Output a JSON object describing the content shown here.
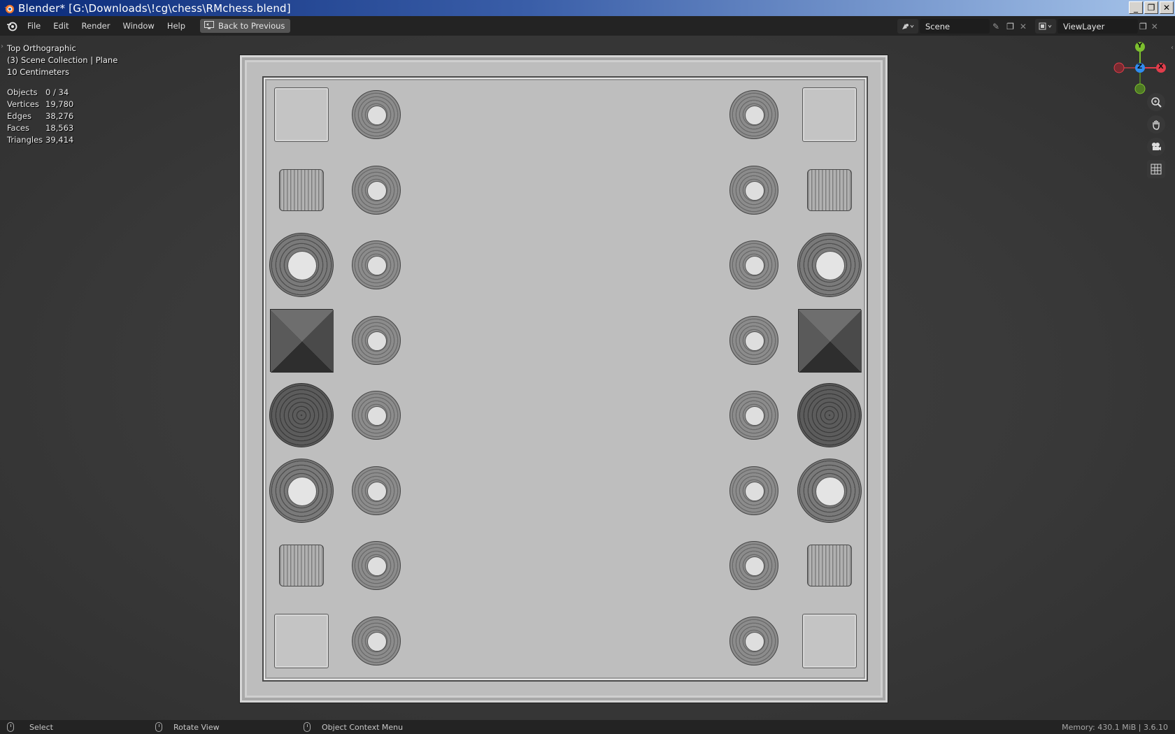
{
  "window": {
    "title": "Blender* [G:\\Downloads\\!cg\\chess\\RMchess.blend]",
    "minimize_glyph": "_",
    "restore_glyph": "❐",
    "close_glyph": "✕"
  },
  "menu": {
    "items": [
      "File",
      "Edit",
      "Render",
      "Window",
      "Help"
    ],
    "back_button": "Back to Previous"
  },
  "header_right": {
    "scene": "Scene",
    "view_layer": "ViewLayer"
  },
  "viewport": {
    "view_name": "Top Orthographic",
    "collection": "(3) Scene Collection | Plane",
    "grid_scale": "10 Centimeters",
    "stats": [
      {
        "label": "Objects",
        "value": "0 / 34"
      },
      {
        "label": "Vertices",
        "value": "19,780"
      },
      {
        "label": "Edges",
        "value": "38,276"
      },
      {
        "label": "Faces",
        "value": "18,563"
      },
      {
        "label": "Triangles",
        "value": "39,414"
      }
    ],
    "gizmo": {
      "y": "Y",
      "z": "Z",
      "x": "X"
    },
    "colors": {
      "x_axis": "#e23d4b",
      "y_axis": "#7cbf2e",
      "z_axis": "#2f8cf0"
    }
  },
  "board": {
    "pieces_left_column": [
      "tile",
      "knight",
      "rook",
      "pyramid",
      "cone",
      "rook",
      "knight",
      "tile"
    ],
    "pieces_right_column": [
      "tile",
      "knight",
      "rook",
      "pyramid",
      "cone",
      "rook",
      "knight",
      "tile"
    ],
    "pawn_rows": 8
  },
  "statusbar": {
    "select": "Select",
    "rotate": "Rotate View",
    "context_menu": "Object Context Menu",
    "memory": "Memory: 430.1 MiB | 3.6.10"
  }
}
